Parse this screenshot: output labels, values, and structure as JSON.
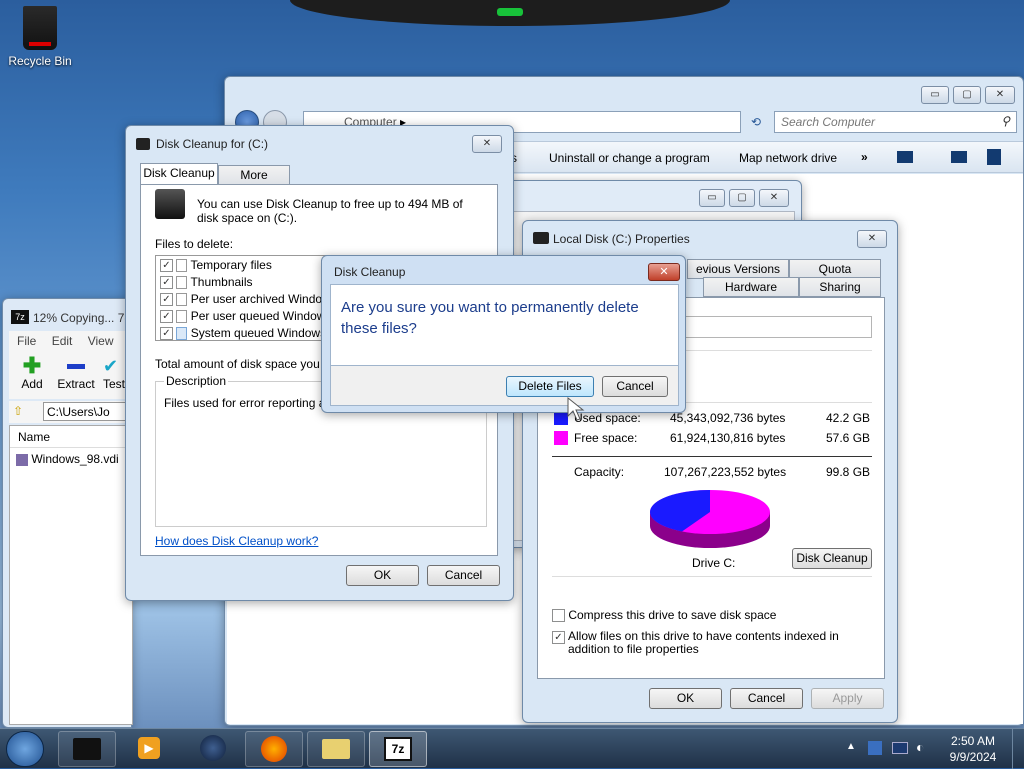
{
  "desktop": {
    "recycle_bin_label": "Recycle Bin"
  },
  "explorer": {
    "address_path": "Computer",
    "search_placeholder": "Search Computer",
    "toolbar": {
      "partial_item": "s",
      "uninstall": "Uninstall or change a program",
      "map_drive": "Map network drive",
      "more": "»"
    }
  },
  "zip": {
    "title": "12% Copying... 7-",
    "menu": [
      "File",
      "Edit",
      "View"
    ],
    "tools": {
      "add": "Add",
      "extract": "Extract",
      "test": "Test"
    },
    "path": "C:\\Users\\Jo",
    "col_name": "Name",
    "file": "Windows_98.vdi"
  },
  "diskcleanup": {
    "title": "Disk Cleanup for  (C:)",
    "tabs": [
      "Disk Cleanup",
      "More Options"
    ],
    "intro": "You can use Disk Cleanup to free up to 494 MB of disk space on  (C:).",
    "files_label": "Files to delete:",
    "files": [
      "Temporary files",
      "Thumbnails",
      "Per user archived Windows",
      "Per user queued Windows",
      "System queued Windows E"
    ],
    "total_label": "Total amount of disk space you gai",
    "desc_label": "Description",
    "desc_text": "Files used for error reporting and s",
    "help_link": "How does Disk Cleanup work?",
    "ok": "OK",
    "cancel": "Cancel"
  },
  "confirm": {
    "title": "Disk Cleanup",
    "message": "Are you sure you want to permanently delete these files?",
    "delete": "Delete Files",
    "cancel": "Cancel"
  },
  "props": {
    "title": "Local Disk (C:) Properties",
    "tabs_top": [
      "evious Versions",
      "Quota"
    ],
    "tabs_bottom": [
      "Hardware",
      "Sharing"
    ],
    "used_label": "Used space:",
    "used_bytes": "45,343,092,736 bytes",
    "used_gb": "42.2 GB",
    "free_label": "Free space:",
    "free_bytes": "61,924,130,816 bytes",
    "free_gb": "57.6 GB",
    "cap_label": "Capacity:",
    "cap_bytes": "107,267,223,552 bytes",
    "cap_gb": "99.8 GB",
    "drive_label": "Drive C:",
    "cleanup_btn": "Disk Cleanup",
    "compress": "Compress this drive to save disk space",
    "index": "Allow files on this drive to have contents indexed in addition to file properties",
    "ok": "OK",
    "cancel": "Cancel",
    "apply": "Apply",
    "used_color": "#1a1aff",
    "free_color": "#ff00ff",
    "used_fraction": 0.4227
  },
  "tray": {
    "time": "2:50 AM",
    "date": "9/9/2024"
  }
}
